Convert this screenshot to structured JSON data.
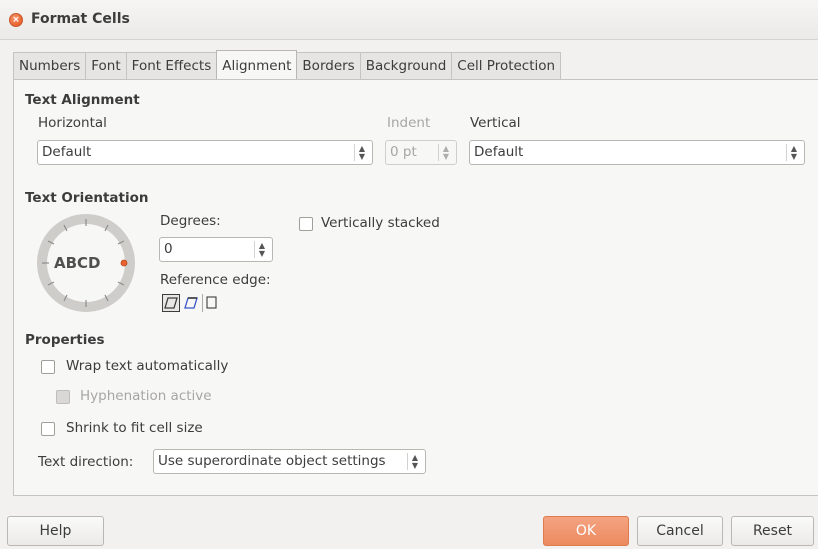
{
  "window": {
    "title": "Format Cells"
  },
  "tabs": [
    "Numbers",
    "Font",
    "Font Effects",
    "Alignment",
    "Borders",
    "Background",
    "Cell Protection"
  ],
  "active_tab": "Alignment",
  "text_alignment": {
    "heading": "Text Alignment",
    "horizontal_label": "Horizontal",
    "horizontal_value": "Default",
    "indent_label": "Indent",
    "indent_value": "0 pt",
    "vertical_label": "Vertical",
    "vertical_value": "Default"
  },
  "text_orientation": {
    "heading": "Text Orientation",
    "dial_text": "ABCD",
    "degrees_label": "Degrees:",
    "degrees_value": "0",
    "reference_edge_label": "Reference edge:",
    "vertically_stacked_label": "Vertically stacked",
    "vertically_stacked_checked": false
  },
  "properties": {
    "heading": "Properties",
    "wrap_label": "Wrap text automatically",
    "wrap_checked": false,
    "hyphenation_label": "Hyphenation active",
    "hyphenation_checked": false,
    "shrink_label": "Shrink to fit cell size",
    "shrink_checked": false,
    "text_direction_label": "Text direction:",
    "text_direction_value": "Use superordinate object settings"
  },
  "buttons": {
    "help": "Help",
    "ok": "OK",
    "cancel": "Cancel",
    "reset": "Reset"
  },
  "colors": {
    "accent": "#e9622f",
    "ok_button": "#ec8a5f",
    "background": "#f2f1f0"
  }
}
